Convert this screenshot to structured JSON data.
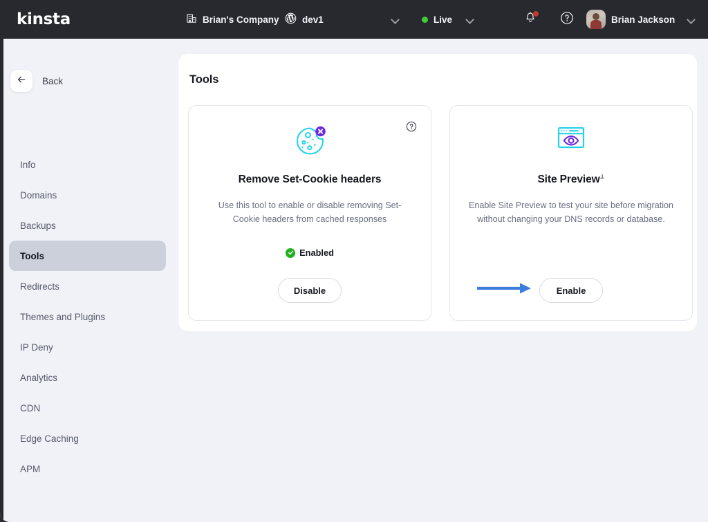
{
  "topbar": {
    "logo": "kinsta",
    "company": {
      "label": "Brian's Company",
      "icon": "building-icon"
    },
    "site": {
      "label": "dev1",
      "icon": "wordpress-icon"
    },
    "site_chevron": "chevron-down-icon",
    "environment": {
      "label": "Live",
      "dot_color": "#3fcc35",
      "chevron": "chevron-down-icon"
    },
    "notifications": {
      "icon": "bell-icon",
      "has_badge": true,
      "badge_color": "#c0392b"
    },
    "help": {
      "icon": "question-circle-icon"
    },
    "user": {
      "name": "Brian Jackson",
      "avatar": "user-avatar",
      "chevron": "chevron-down-icon"
    }
  },
  "sidebar": {
    "back": {
      "label": "Back",
      "icon": "arrow-left-icon"
    },
    "items": [
      {
        "label": "Info",
        "active": false
      },
      {
        "label": "Domains",
        "active": false
      },
      {
        "label": "Backups",
        "active": false
      },
      {
        "label": "Tools",
        "active": true
      },
      {
        "label": "Redirects",
        "active": false
      },
      {
        "label": "Themes and Plugins",
        "active": false
      },
      {
        "label": "IP Deny",
        "active": false
      },
      {
        "label": "Analytics",
        "active": false
      },
      {
        "label": "CDN",
        "active": false
      },
      {
        "label": "Edge Caching",
        "active": false
      },
      {
        "label": "APM",
        "active": false
      }
    ]
  },
  "main": {
    "title": "Tools",
    "cards": [
      {
        "id": "remove-set-cookie-headers",
        "icon": "cookie-blocked-icon",
        "icon_colors": {
          "primary": "#22d3e8",
          "badge": "#6d28e0"
        },
        "help_icon": "question-circle-icon",
        "title": "Remove Set-Cookie headers",
        "title_sup": "",
        "description": "Use this tool to enable or disable removing Set-Cookie headers from cached responses",
        "status": {
          "label": "Enabled",
          "icon": "check-circle-icon",
          "color": "#20b020"
        },
        "button": "Disable"
      },
      {
        "id": "site-preview",
        "icon": "browser-eye-icon",
        "icon_colors": {
          "primary": "#22d3e8",
          "badge": "#6d28e0"
        },
        "help_icon": "",
        "title": "Site Preview",
        "title_sup": "⊥",
        "description": "Enable Site Preview to test your site before migration without changing your DNS records or database.",
        "status": {
          "label": "",
          "icon": "",
          "color": ""
        },
        "button": "Enable"
      }
    ]
  },
  "annotation": {
    "arrow": {
      "color": "#3b7ddd",
      "points_to": "enable-button"
    }
  }
}
